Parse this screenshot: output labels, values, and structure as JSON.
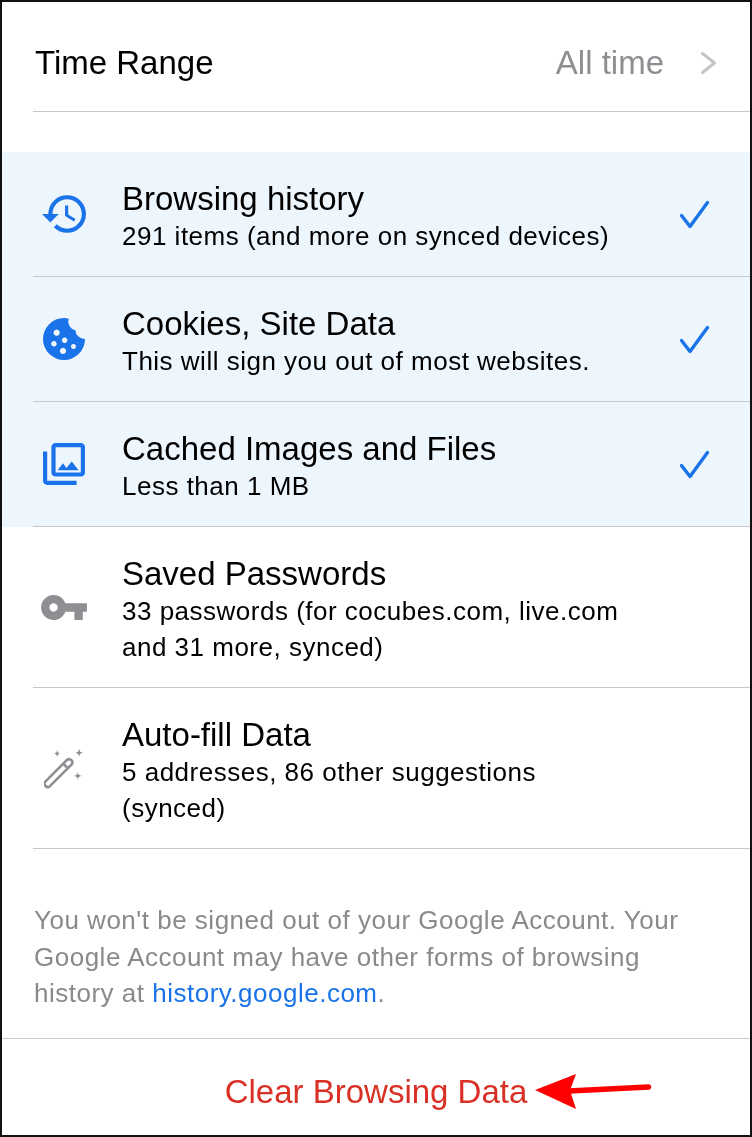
{
  "time_range": {
    "label": "Time Range",
    "value": "All time"
  },
  "items": [
    {
      "kind": "history",
      "title": "Browsing history",
      "detail": "291 items (and more on synced devices)",
      "checked": true
    },
    {
      "kind": "cookies",
      "title": "Cookies, Site Data",
      "detail": "This will sign you out of most websites.",
      "checked": true
    },
    {
      "kind": "cache",
      "title": "Cached Images and Files",
      "detail": "Less than 1 MB",
      "checked": true
    },
    {
      "kind": "passwords",
      "title": "Saved Passwords",
      "detail": "33 passwords (for cocubes.com, live.com and 31 more, synced)",
      "checked": false
    },
    {
      "kind": "autofill",
      "title": "Auto-fill Data",
      "detail": "5 addresses, 86 other suggestions (synced)",
      "checked": false
    }
  ],
  "footer": {
    "text": "You won't be signed out of your Google Account. Your Google Account may have other forms of browsing history at ",
    "link": "history.google.com",
    "text_end": "."
  },
  "clear_button": {
    "label": "Clear Browsing Data"
  }
}
